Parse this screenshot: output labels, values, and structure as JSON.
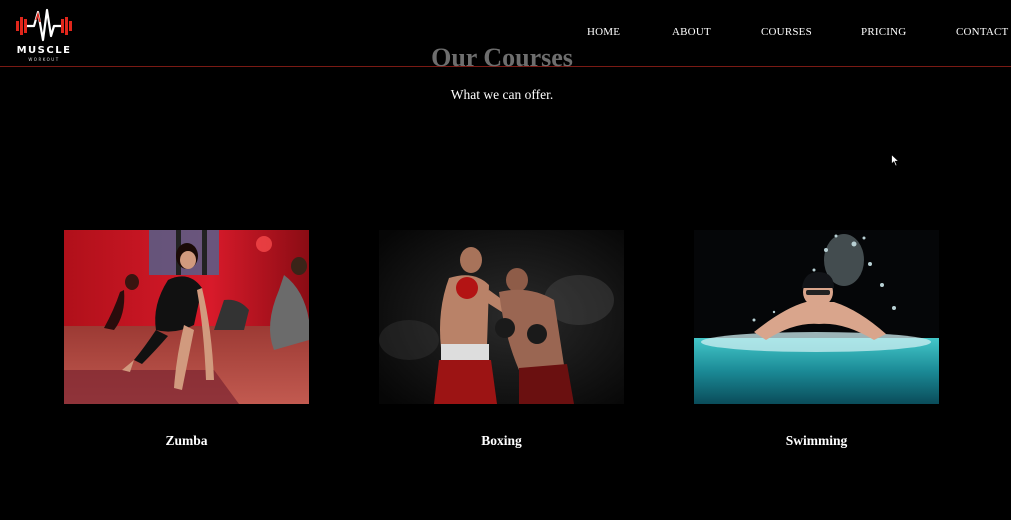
{
  "brand": {
    "name": "MUSCLE",
    "tagline": "WORKOUT",
    "logo_icon": "barbell-heartbeat-icon",
    "accent_color": "#e0261b"
  },
  "nav": {
    "items": [
      {
        "label": "HOME"
      },
      {
        "label": "ABOUT"
      },
      {
        "label": "COURSES"
      },
      {
        "label": "PRICING"
      },
      {
        "label": "CONTACT"
      }
    ]
  },
  "courses_section": {
    "title": "Our Courses",
    "subtitle": "What we can offer.",
    "courses": [
      {
        "name": "Zumba",
        "image_alt": "group stretching class in red-lit studio"
      },
      {
        "name": "Boxing",
        "image_alt": "two boxers sparring"
      },
      {
        "name": "Swimming",
        "image_alt": "swimmer splashing in pool"
      }
    ]
  },
  "colors": {
    "background": "#000000",
    "divider": "#7a1a14",
    "title_gray": "#6e6e6e"
  }
}
